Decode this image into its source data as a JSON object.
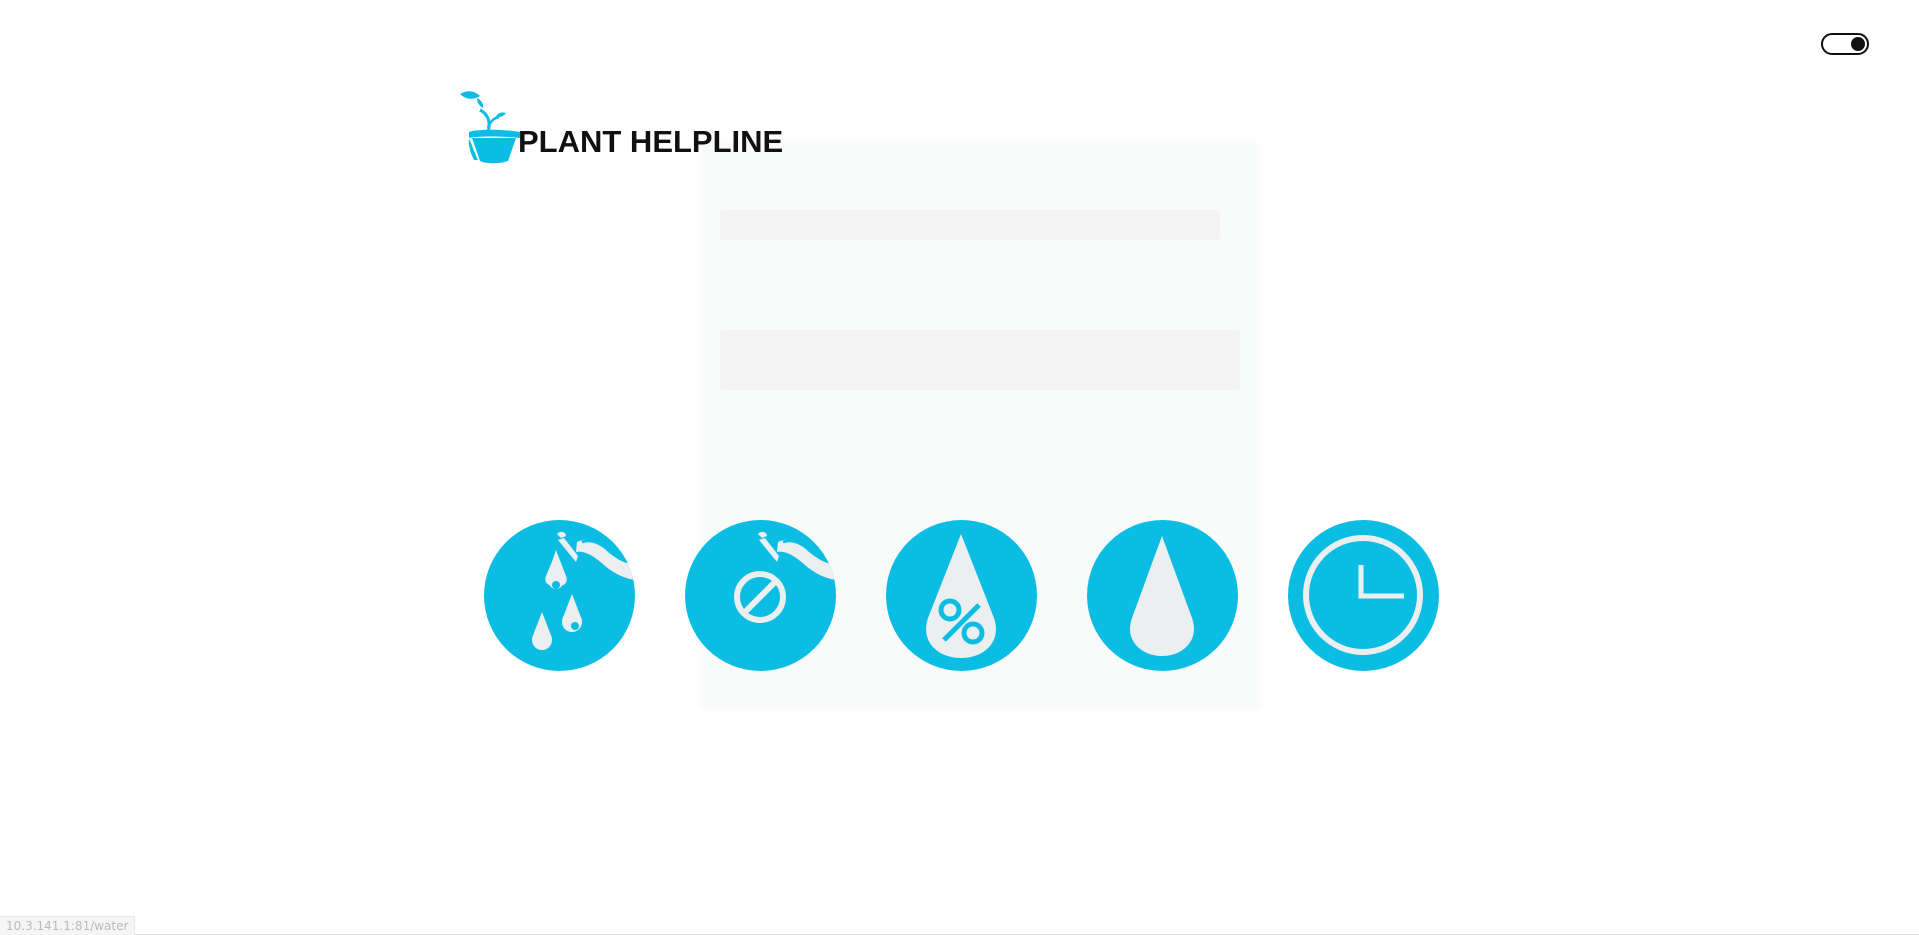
{
  "app": {
    "title": "PLANT HELPLINE"
  },
  "theme_toggle": {
    "state": "on"
  },
  "buttons": [
    {
      "name": "water-plant",
      "icon": "watering-can-drops-icon"
    },
    {
      "name": "stop-watering",
      "icon": "watering-can-no-icon"
    },
    {
      "name": "moisture-percent",
      "icon": "drop-percent-icon"
    },
    {
      "name": "water-level",
      "icon": "drop-icon"
    },
    {
      "name": "schedule",
      "icon": "clock-icon"
    }
  ],
  "status_bar": {
    "url": "10.3.141.1:81/water"
  },
  "colors": {
    "accent": "#0bbde3",
    "icon_fill": "#eceff0",
    "text": "#111111"
  }
}
